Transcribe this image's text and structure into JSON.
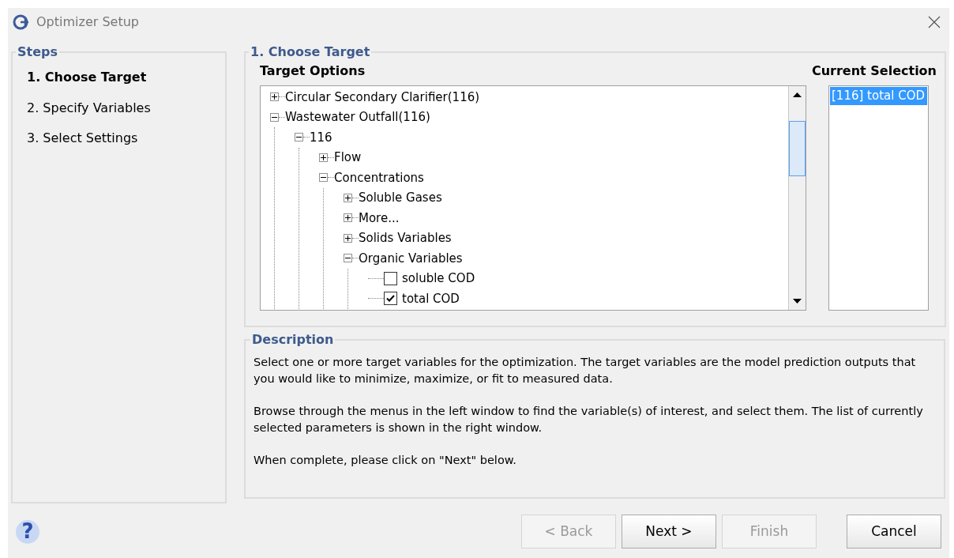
{
  "window": {
    "title": "Optimizer Setup"
  },
  "steps": {
    "title": "Steps",
    "items": [
      {
        "label": "1. Choose Target",
        "selected": true
      },
      {
        "label": "2. Specify Variables",
        "selected": false
      },
      {
        "label": "3. Select Settings",
        "selected": false
      }
    ]
  },
  "choose_target": {
    "title": "1. Choose Target",
    "target_options_label": "Target Options",
    "current_selection_label": "Current Selection",
    "tree": [
      {
        "label": "Circular Secondary Clarifier(116)",
        "expanded": false
      },
      {
        "label": "Wastewater Outfall(116)",
        "expanded": true,
        "children": [
          {
            "label": "116",
            "expanded": true,
            "children": [
              {
                "label": "Flow",
                "expanded": false
              },
              {
                "label": "Concentrations",
                "expanded": true,
                "children": [
                  {
                    "label": "Soluble Gases",
                    "expanded": false
                  },
                  {
                    "label": "More...",
                    "expanded": false
                  },
                  {
                    "label": "Solids Variables",
                    "expanded": false
                  },
                  {
                    "label": "Organic Variables",
                    "expanded": true,
                    "children": [
                      {
                        "label": "soluble COD",
                        "kind": "checkbox",
                        "checked": false
                      },
                      {
                        "label": "total COD",
                        "kind": "checkbox",
                        "checked": true
                      }
                    ]
                  }
                ]
              }
            ]
          }
        ]
      }
    ],
    "current_selection": [
      {
        "label": "[116] total COD",
        "selected": true
      }
    ]
  },
  "description": {
    "title": "Description",
    "paragraphs": [
      "Select one or more target variables for the optimization. The target variables are the model prediction outputs that you would like to minimize, maximize, or fit to measured data.",
      "Browse through the menus in the left window to find the variable(s) of interest, and select them. The list of currently selected parameters is shown in the right window.",
      "When complete, please click on \"Next\" below."
    ]
  },
  "help_icon": "?",
  "buttons": [
    {
      "label": "< Back",
      "disabled": true
    },
    {
      "label": "Next >",
      "disabled": false
    },
    {
      "label": "Finish",
      "disabled": true
    },
    {
      "label": "Cancel",
      "disabled": false
    }
  ]
}
